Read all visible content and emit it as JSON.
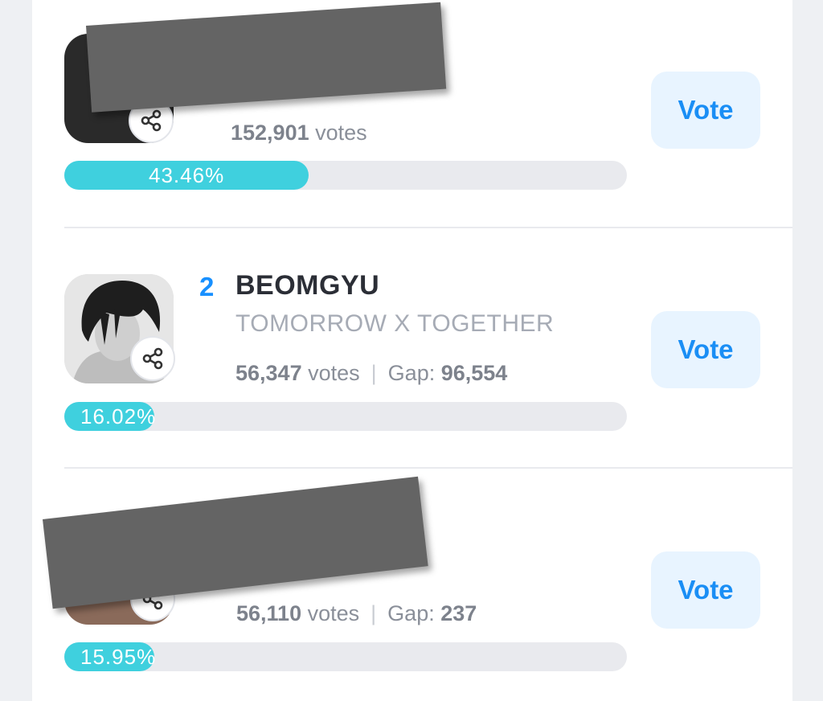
{
  "vote_label": "Vote",
  "colors": {
    "accent": "#1a8ef5",
    "bar_fill": "#3fd0de",
    "bar_track": "#e9eaee",
    "vote_bg": "#e8f4ff",
    "redaction": "#646464"
  },
  "entries": [
    {
      "votes": "152,901",
      "votes_unit": "votes",
      "percent_label": "43.46%",
      "percent_value": 43.46,
      "redacted": true
    },
    {
      "rank": "2",
      "name": "BEOMGYU",
      "group": "TOMORROW X TOGETHER",
      "votes": "56,347",
      "votes_unit": "votes",
      "gap_label": "Gap:",
      "gap": "96,554",
      "percent_label": "16.02%",
      "percent_value": 16.02,
      "avatar_icon": "profile-photo",
      "share_icon": "share-icon"
    },
    {
      "votes": "56,110",
      "votes_unit": "votes",
      "gap_label": "Gap:",
      "gap": "237",
      "percent_label": "15.95%",
      "percent_value": 15.95,
      "redacted": true
    }
  ]
}
